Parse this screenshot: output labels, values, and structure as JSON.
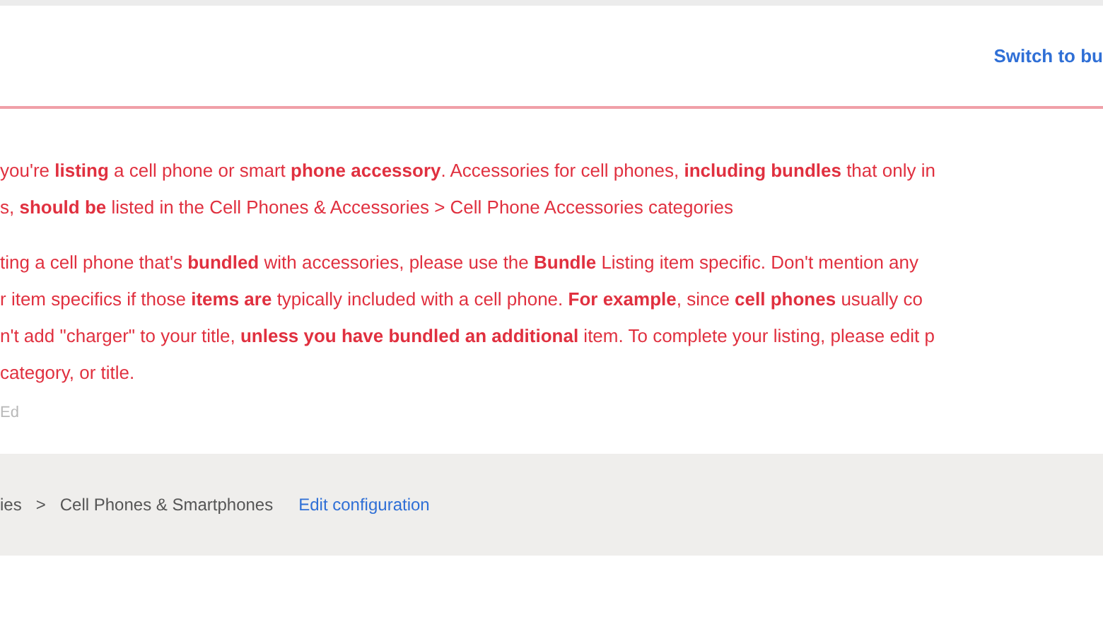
{
  "header": {
    "link": "Switch to bu"
  },
  "alert": {
    "paragraphs": [
      [
        "you're **listing** a cell phone or smart **phone accessory**. Accessories for cell phones, **including bundles** that only in",
        "s, **should be** listed in the Cell Phones & Accessories > Cell Phone Accessories categories"
      ],
      [
        "ting a cell phone that's **bundled** with accessories, please use the **Bundle** Listing item specific. Don't mention any",
        "r item specifics if those **items are** typically included with a cell phone. **For example**, since **cell phones** usually co",
        "n't add \"charger\" to your title, **unless you have bundled an additional** item. To complete your listing, please edit p",
        "category, or title."
      ]
    ],
    "footnote": "Ed"
  },
  "category_bar": {
    "path": "ies",
    "separator": ">",
    "category": "Cell Phones & Smartphones",
    "edit_link": "Edit configuration"
  }
}
